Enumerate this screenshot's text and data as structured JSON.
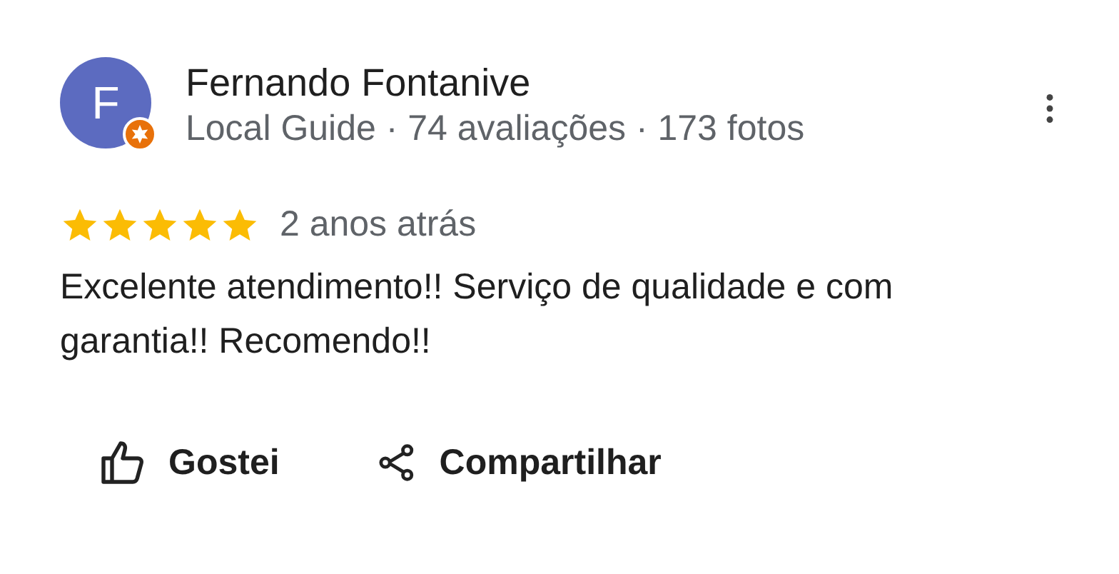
{
  "review": {
    "avatar_letter": "F",
    "author": "Fernando Fontanive",
    "author_meta": "Local Guide · 74 avaliações · 173 fotos",
    "stars": 5,
    "time": "2 anos atrás",
    "text": "Excelente atendimento!! Serviço de qualidade e com garantia!! Recomendo!!"
  },
  "actions": [
    {
      "kind": "like",
      "label": "Gostei"
    },
    {
      "kind": "share",
      "label": "Compartilhar"
    }
  ]
}
